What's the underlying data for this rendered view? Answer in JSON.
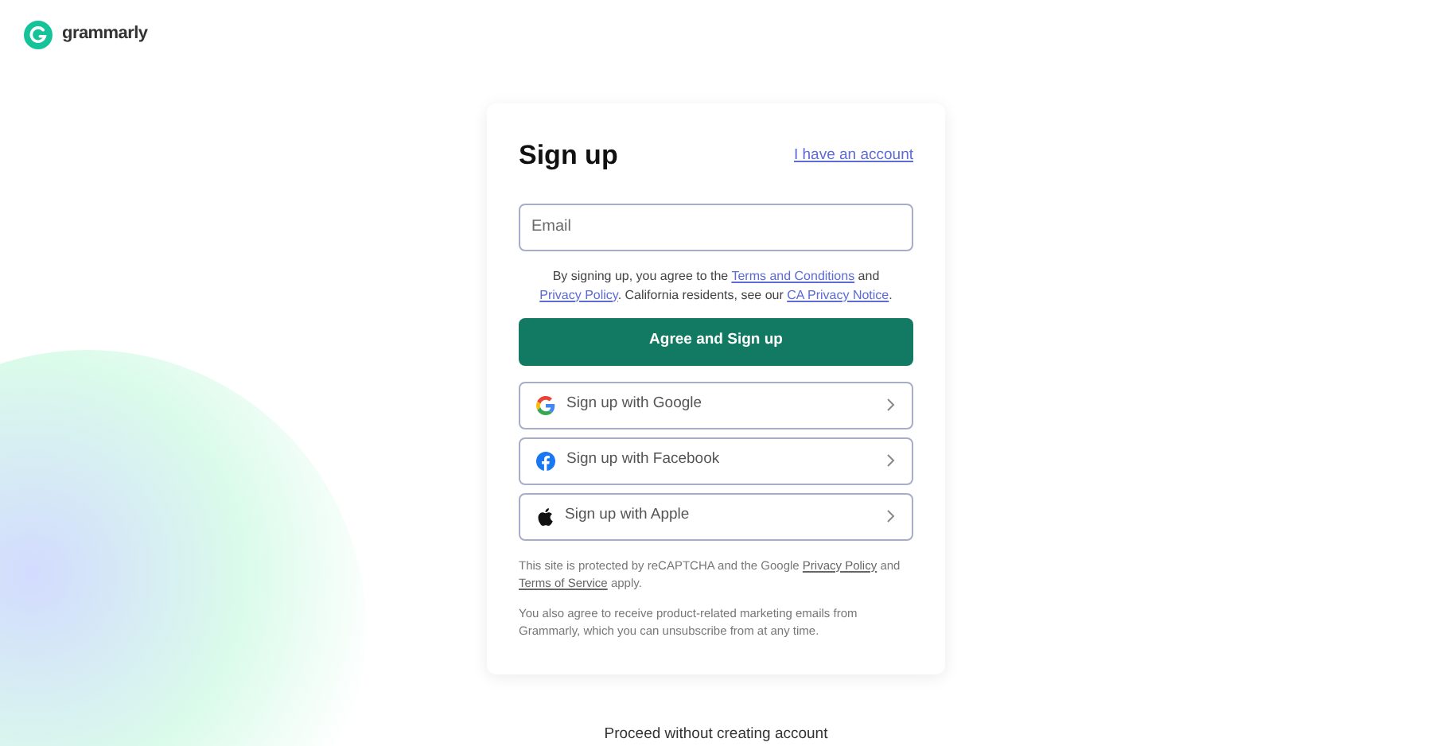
{
  "logo": {
    "text": "grammarly"
  },
  "card": {
    "title": "Sign up",
    "account_link": "I have an account",
    "email": {
      "placeholder": "Email"
    },
    "terms": [
      {
        "text": "By signing up, you agree to the "
      },
      {
        "text": "Terms and Conditions",
        "link": true
      },
      {
        "text": " and "
      },
      {
        "text": "Privacy Policy",
        "link": true
      },
      {
        "text": ". California residents, see our "
      },
      {
        "text": "CA Privacy Notice",
        "link": true
      },
      {
        "text": "."
      }
    ],
    "primary_button": "Agree and Sign up",
    "providers": [
      {
        "kind": "google",
        "label": "Sign up with Google"
      },
      {
        "kind": "facebook",
        "label": "Sign up with Facebook"
      },
      {
        "kind": "apple",
        "label": "Sign up with Apple"
      }
    ],
    "recaptcha": [
      {
        "text": "This site is protected by reCAPTCHA and the Google "
      },
      {
        "text": "Privacy Policy",
        "link": true
      },
      {
        "text": " and "
      },
      {
        "text": "Terms of Service",
        "link": true
      },
      {
        "text": " apply."
      }
    ],
    "marketing": "You also agree to receive product-related marketing emails from Grammarly, which you can unsubscribe from at any time."
  },
  "footer_link": "Proceed without creating account"
}
